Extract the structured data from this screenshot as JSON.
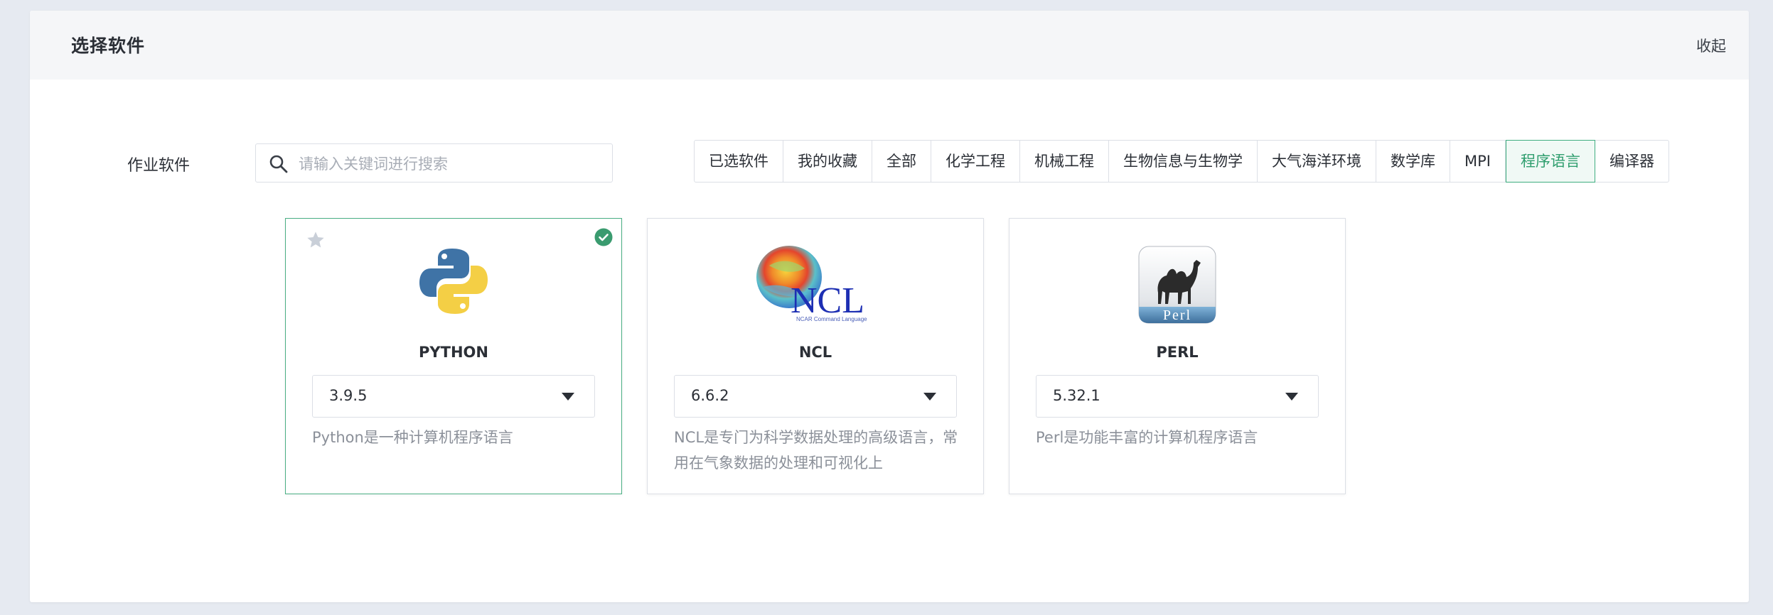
{
  "header": {
    "title": "选择软件",
    "collapse_label": "收起"
  },
  "form": {
    "label": "作业软件",
    "search_placeholder": "请输入关键词进行搜索"
  },
  "filters": {
    "tabs": [
      {
        "label": "已选软件",
        "active": false
      },
      {
        "label": "我的收藏",
        "active": false
      },
      {
        "label": "全部",
        "active": false
      },
      {
        "label": "化学工程",
        "active": false
      },
      {
        "label": "机械工程",
        "active": false
      },
      {
        "label": "生物信息与生物学",
        "active": false
      },
      {
        "label": "大气海洋环境",
        "active": false
      },
      {
        "label": "数学库",
        "active": false
      },
      {
        "label": "MPI",
        "active": false
      },
      {
        "label": "程序语言",
        "active": true
      },
      {
        "label": "编译器",
        "active": false
      }
    ]
  },
  "software": [
    {
      "name": "PYTHON",
      "version": "3.9.5",
      "description": "Python是一种计算机程序语言",
      "selected": true,
      "logo_icon": "python-logo-icon"
    },
    {
      "name": "NCL",
      "version": "6.6.2",
      "description": "NCL是专门为科学数据处理的高级语言，常用在气象数据的处理和可视化上",
      "selected": false,
      "logo_icon": "ncl-logo-icon",
      "logo_text": "NCL",
      "logo_subtext": "NCAR Command Language"
    },
    {
      "name": "PERL",
      "version": "5.32.1",
      "description": "Perl是功能丰富的计算机程序语言",
      "selected": false,
      "logo_icon": "perl-logo-icon",
      "logo_text": "Perl"
    }
  ],
  "colors": {
    "accent_green": "#3fae80",
    "check_green": "#3a9b6f",
    "background": "#e6eaf1"
  }
}
